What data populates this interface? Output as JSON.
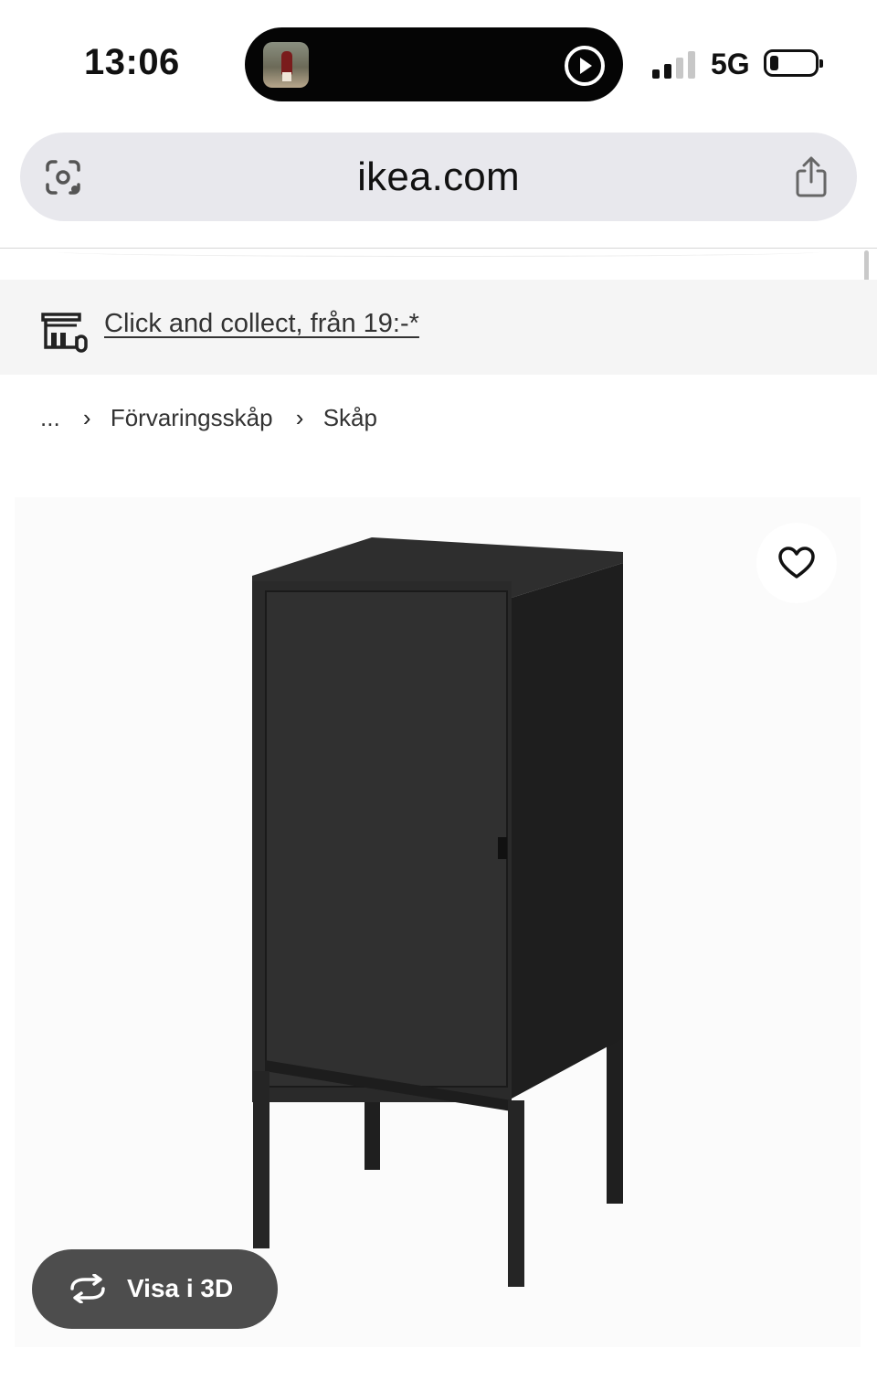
{
  "status_bar": {
    "time": "13:06",
    "network": "5G",
    "signal_bars_active": 2,
    "signal_bars_total": 4,
    "battery_level": 0.15,
    "dynamic_island": {
      "thumbnail_icon": "now-playing-thumbnail",
      "control_icon": "play-circle-icon"
    }
  },
  "browser": {
    "url": "ikea.com",
    "left_icon": "visual-lookup-icon",
    "right_icon": "share-icon"
  },
  "banner": {
    "icon": "store-icon",
    "link_text": "Click and collect, från 19:-*"
  },
  "breadcrumb": {
    "ellipsis": "...",
    "separator": "›",
    "items": [
      "Förvaringsskåp",
      "Skåp"
    ]
  },
  "product": {
    "image_icon": "cabinet-image",
    "favorite_icon": "heart-icon",
    "view_3d_label": "Visa i 3D",
    "view_3d_icon": "rotate-3d-icon",
    "colors": {
      "panel_bg": "#fbfbfb",
      "cabinet": "#2b2b2b",
      "button_bg": "#4d4d4d"
    }
  }
}
